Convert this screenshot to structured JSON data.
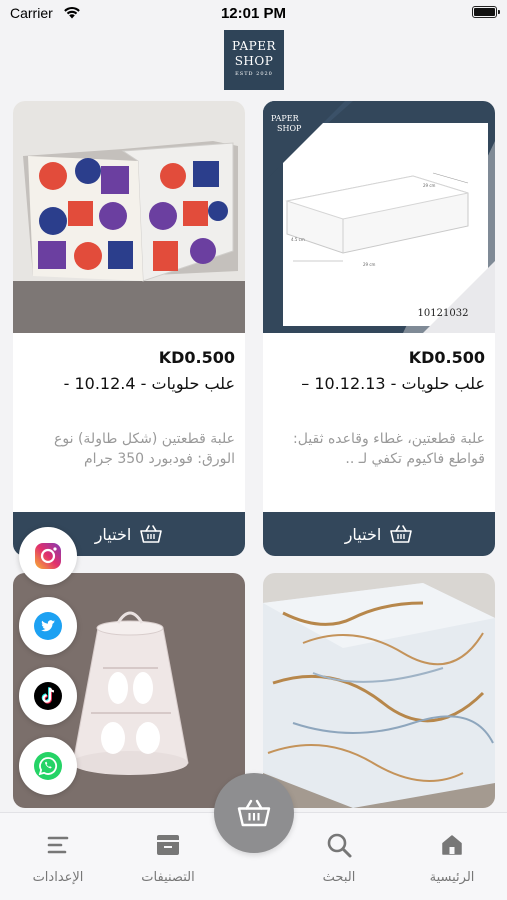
{
  "status_bar": {
    "carrier": "Carrier",
    "time": "12:01 PM"
  },
  "logo": {
    "line1": "PAPER",
    "line2": "SHOP",
    "line3": "ESTD 2020"
  },
  "products": [
    {
      "price": "KD0.500",
      "name": "علب حلويات - 10.12.13 –",
      "description": "علبة قطعتين، غطاء وقاعده ثقيل: قواطع فاكيوم تكفي لـ ..",
      "choose_label": "اختيار",
      "image_label": "10121032",
      "image_logo": "PAPER SHOP"
    },
    {
      "price": "KD0.500",
      "name": "علب حلويات - 10.12.4 -",
      "description": "علبة قطعتين (شكل طاولة) نوع الورق: فودبورد 350 جرام",
      "choose_label": "اختيار"
    }
  ],
  "social": [
    {
      "name": "instagram",
      "color": "#e1306c"
    },
    {
      "name": "twitter",
      "color": "#1da1f2"
    },
    {
      "name": "tiktok",
      "color": "#000000"
    },
    {
      "name": "whatsapp",
      "color": "#25d366"
    }
  ],
  "tabs": {
    "home": "الرئيسية",
    "search": "البحث",
    "categories": "التصنيفات",
    "settings": "الإعدادات"
  },
  "colors": {
    "accent": "#33475b",
    "background": "#f3f3f5",
    "fab": "#8e8e90"
  }
}
